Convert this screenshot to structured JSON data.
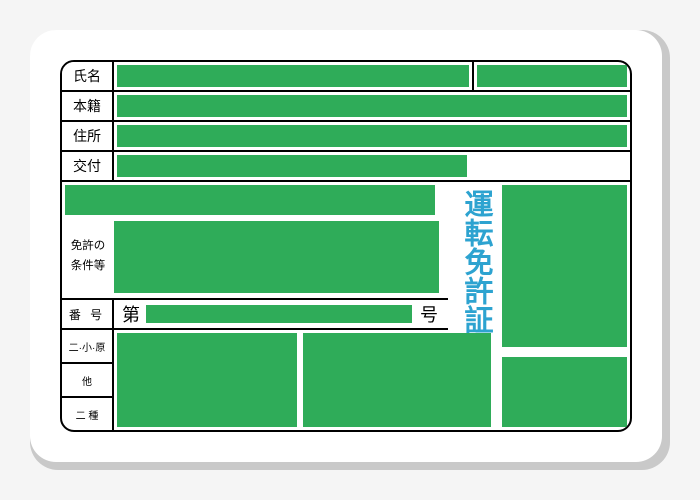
{
  "labels": {
    "name": "氏名",
    "domicile": "本籍",
    "address": "住所",
    "issued": "交付",
    "conditions_l1": "免許の",
    "conditions_l2": "条件等",
    "number": "番 号",
    "number_prefix": "第",
    "number_suffix": "号",
    "class_a": "二·小·原",
    "class_b": "他",
    "class_c": "二 種"
  },
  "title": "運転免許証"
}
